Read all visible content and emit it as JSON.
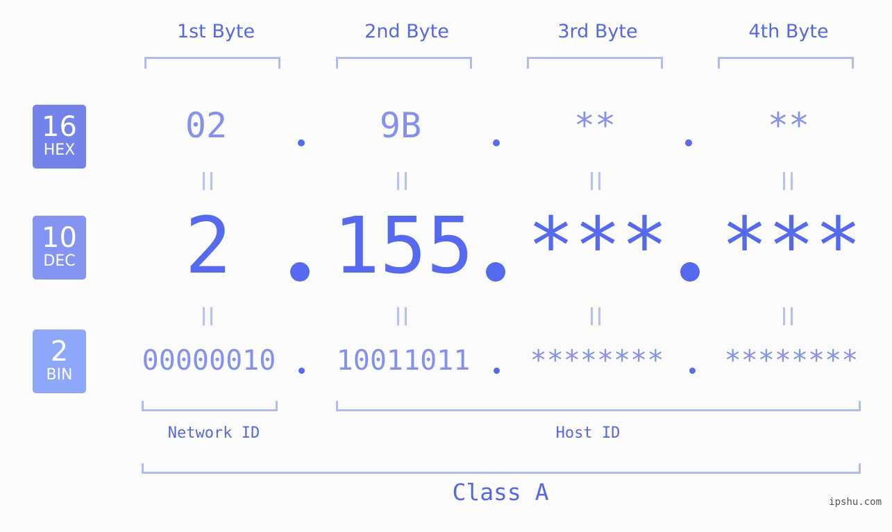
{
  "byte_headers": [
    "1st Byte",
    "2nd Byte",
    "3rd Byte",
    "4th Byte"
  ],
  "bases": [
    {
      "number": "16",
      "name": "HEX",
      "color": "#7383ea"
    },
    {
      "number": "10",
      "name": "DEC",
      "color": "#8594f1"
    },
    {
      "number": "2",
      "name": "BIN",
      "color": "#8fa7f8"
    }
  ],
  "hex": [
    "02",
    "9B",
    "**",
    "**"
  ],
  "dec": [
    "2",
    "155",
    "***",
    "***"
  ],
  "bin": [
    "00000010",
    "10011011",
    "********",
    "********"
  ],
  "separator": ".",
  "equals_symbol": "=",
  "network_label": "Network ID",
  "host_label": "Host ID",
  "class_label": "Class A",
  "watermark": "ipshu.com",
  "colors": {
    "primary": "#566af0",
    "light_text": "#8591ec",
    "bracket": "#b1bcf5",
    "background": "#fbfcfb"
  }
}
